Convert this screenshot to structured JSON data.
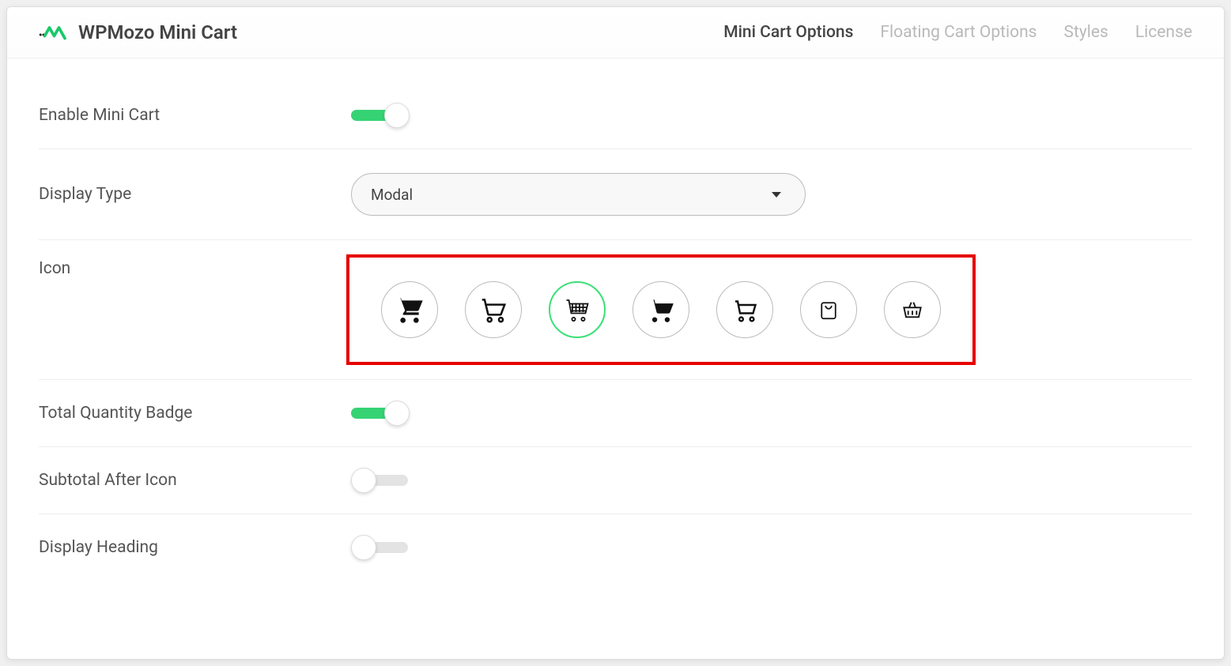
{
  "brand": {
    "title": "WPMozo Mini Cart"
  },
  "tabs": [
    {
      "label": "Mini Cart Options",
      "active": true
    },
    {
      "label": "Floating Cart Options",
      "active": false
    },
    {
      "label": "Styles",
      "active": false
    },
    {
      "label": "License",
      "active": false
    }
  ],
  "settings": {
    "enable_mini_cart": {
      "label": "Enable Mini Cart",
      "on": true
    },
    "display_type": {
      "label": "Display Type",
      "value": "Modal"
    },
    "icon": {
      "label": "Icon",
      "selected_index": 2,
      "options": [
        "cart-filled-1",
        "cart-outline-1",
        "cart-grid",
        "cart-filled-2",
        "cart-outline-2",
        "bag",
        "basket"
      ]
    },
    "total_quantity_badge": {
      "label": "Total Quantity Badge",
      "on": true
    },
    "subtotal_after_icon": {
      "label": "Subtotal After Icon",
      "on": false
    },
    "display_heading": {
      "label": "Display Heading",
      "on": false
    }
  }
}
